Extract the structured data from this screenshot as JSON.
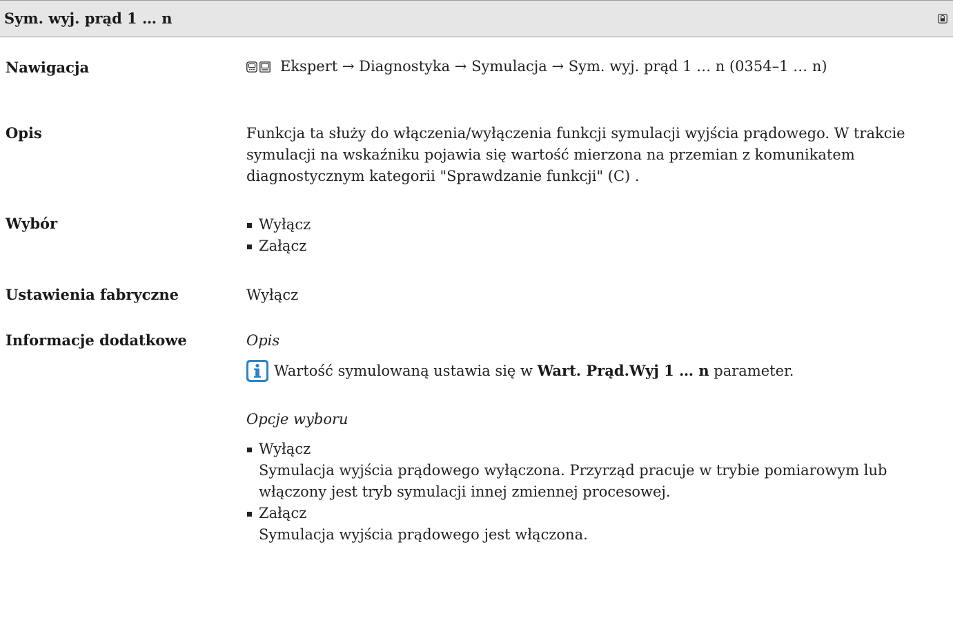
{
  "header": {
    "title": "Sym. wyj. prąd 1 … n",
    "lock_icon": "lock-icon"
  },
  "rows": {
    "nawigacja": {
      "label": "Nawigacja",
      "icons": [
        "display-keypad-icon",
        "operating-tool-icon"
      ],
      "path": "Ekspert → Diagnostyka → Symulacja → Sym. wyj. prąd 1 … n (0354–1 … n)"
    },
    "opis": {
      "label": "Opis",
      "lines": [
        "Funkcja ta służy do włączenia/wyłączenia funkcji symulacji wyjścia prądowego. W trakcie",
        "symulacji na wskaźniku pojawia się wartość mierzona na przemian z komunikatem",
        "diagnostycznym kategorii \"Sprawdzanie funkcji\" (C) ."
      ]
    },
    "wybor": {
      "label": "Wybór",
      "options": [
        "Wyłącz",
        "Załącz"
      ]
    },
    "ustawienia": {
      "label": "Ustawienia fabryczne",
      "value": "Wyłącz"
    },
    "informacje": {
      "label": "Informacje dodatkowe",
      "opis_heading": "Opis",
      "info_icon": "info-icon",
      "note_prefix": "Wartość symulowaną ustawia się w ",
      "note_param": "Wart. Prąd.Wyj 1 … n",
      "note_suffix": " parameter.",
      "opcje_heading": "Opcje wyboru",
      "opcje": [
        {
          "name": "Wyłącz",
          "desc_lines": [
            "Symulacja wyjścia prądowego wyłączona. Przyrząd pracuje w trybie pomiarowym lub",
            "włączony jest tryb symulacji innej zmiennej procesowej."
          ]
        },
        {
          "name": "Załącz",
          "desc_lines": [
            "Symulacja wyjścia prądowego jest włączona."
          ]
        }
      ]
    }
  },
  "colors": {
    "header_bg": "#e6e6e6",
    "text": "#222222",
    "info_blue": "#2a84c6"
  }
}
